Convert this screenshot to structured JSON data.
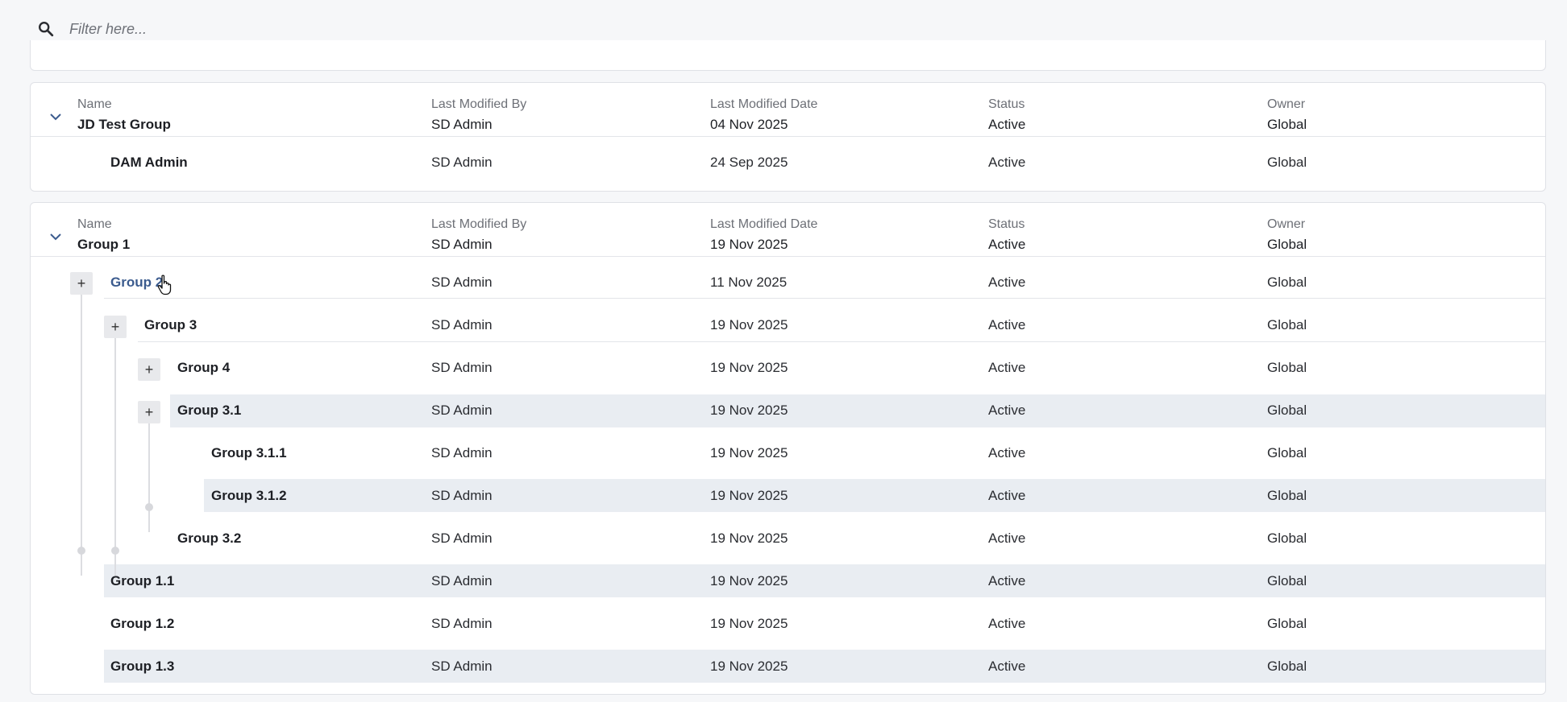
{
  "filter": {
    "placeholder": "Filter here..."
  },
  "columns": {
    "name": "Name",
    "modified_by": "Last Modified By",
    "modified_date": "Last Modified Date",
    "status": "Status",
    "owner": "Owner"
  },
  "groups": [
    {
      "name": "JD Test Group",
      "modified_by": "SD Admin",
      "modified_date": "04 Nov 2025",
      "status": "Active",
      "owner": "Global",
      "rows": [
        {
          "name": "DAM Admin",
          "modified_by": "SD Admin",
          "modified_date": "24 Sep 2025",
          "status": "Active",
          "owner": "Global"
        }
      ]
    },
    {
      "name": "Group 1",
      "modified_by": "SD Admin",
      "modified_date": "19 Nov 2025",
      "status": "Active",
      "owner": "Global",
      "rows": [
        {
          "name": "Group 2",
          "modified_by": "SD Admin",
          "modified_date": "11 Nov 2025",
          "status": "Active",
          "owner": "Global"
        },
        {
          "name": "Group 3",
          "modified_by": "SD Admin",
          "modified_date": "19 Nov 2025",
          "status": "Active",
          "owner": "Global"
        },
        {
          "name": "Group 4",
          "modified_by": "SD Admin",
          "modified_date": "19 Nov 2025",
          "status": "Active",
          "owner": "Global"
        },
        {
          "name": "Group 3.1",
          "modified_by": "SD Admin",
          "modified_date": "19 Nov 2025",
          "status": "Active",
          "owner": "Global"
        },
        {
          "name": "Group 3.1.1",
          "modified_by": "SD Admin",
          "modified_date": "19 Nov 2025",
          "status": "Active",
          "owner": "Global"
        },
        {
          "name": "Group 3.1.2",
          "modified_by": "SD Admin",
          "modified_date": "19 Nov 2025",
          "status": "Active",
          "owner": "Global"
        },
        {
          "name": "Group 3.2",
          "modified_by": "SD Admin",
          "modified_date": "19 Nov 2025",
          "status": "Active",
          "owner": "Global"
        },
        {
          "name": "Group 1.1",
          "modified_by": "SD Admin",
          "modified_date": "19 Nov 2025",
          "status": "Active",
          "owner": "Global"
        },
        {
          "name": "Group 1.2",
          "modified_by": "SD Admin",
          "modified_date": "19 Nov 2025",
          "status": "Active",
          "owner": "Global"
        },
        {
          "name": "Group 1.3",
          "modified_by": "SD Admin",
          "modified_date": "19 Nov 2025",
          "status": "Active",
          "owner": "Global"
        }
      ]
    }
  ],
  "expand_symbol": "+",
  "colors": {
    "link": "#3b5b8e",
    "row_highlight": "#e9edf2",
    "chevron": "#3b5b8e"
  }
}
